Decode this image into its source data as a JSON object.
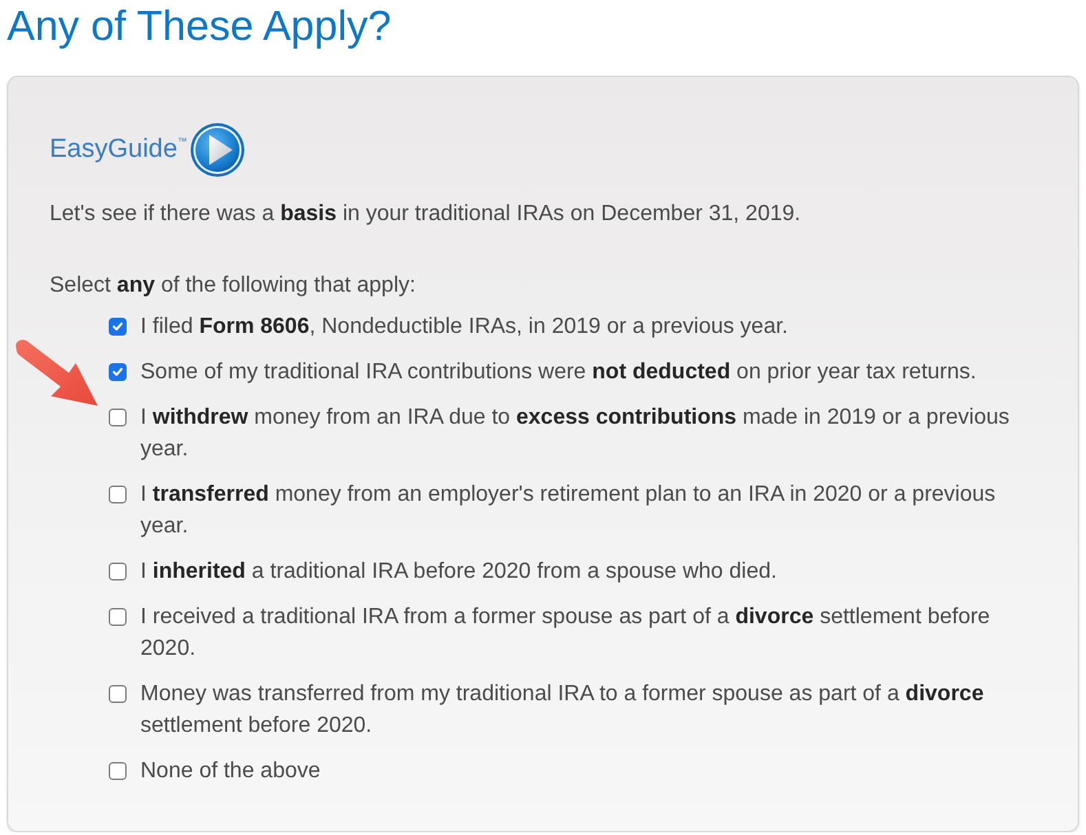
{
  "heading": "Any of These Apply?",
  "guide": {
    "logo": "EasyGuide$^{™}$",
    "intro": "Let's see if there was a **basis** in your traditional IRAs on December 31, 2019.",
    "prompt": "Select **any** of the following that apply:"
  },
  "annotation_arrow": true,
  "options": [
    {
      "label": "I filed **Form 8606**, Nondeductible IRAs, in 2019 or a previous year.",
      "checked": true
    },
    {
      "label": "Some of my traditional IRA contributions were **not deducted** on prior year tax returns.",
      "checked": true
    },
    {
      "label": "I **withdrew** money from an IRA due to **excess contributions** made in 2019 or a previous year.",
      "checked": false
    },
    {
      "label": "I **transferred** money from an employer's retirement plan to an IRA in 2020 or a previous year.",
      "checked": false
    },
    {
      "label": "I **inherited** a traditional IRA before 2020 from a spouse who died.",
      "checked": false
    },
    {
      "label": "I received a traditional IRA from a former spouse as part of a **divorce** settlement before 2020.",
      "checked": false
    },
    {
      "label": "Money was transferred from my traditional IRA to a former spouse as part of a **divorce** settlement before 2020.",
      "checked": false
    },
    {
      "label": "None of the above",
      "checked": false
    }
  ]
}
